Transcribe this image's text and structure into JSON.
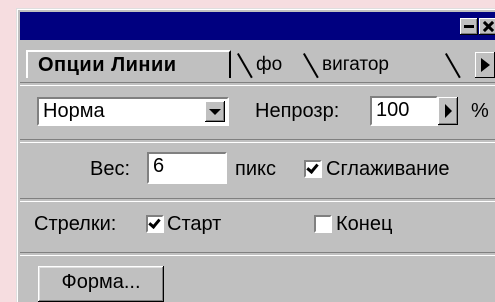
{
  "titlebar": {
    "minimize_icon": "minimize-icon",
    "close_icon": "close-icon",
    "color": "#000080"
  },
  "tabs": [
    {
      "label": "Опции Линии",
      "active": true
    },
    {
      "label": "фо",
      "active": false
    },
    {
      "label": "вигатор",
      "active": false
    }
  ],
  "tabs_scroll_icon": "arrow-right-icon",
  "blend": {
    "mode": "Норма",
    "opacity_label": "Непрозр:",
    "opacity_value": "100",
    "percent": "%"
  },
  "weight": {
    "label": "Вес:",
    "value": "6",
    "unit": "пикс"
  },
  "antialias": {
    "label": "Сглаживание",
    "checked": true
  },
  "arrows": {
    "label": "Стрелки:",
    "start": {
      "label": "Старт",
      "checked": true
    },
    "end": {
      "label": "Конец",
      "checked": false
    }
  },
  "shape_button": "Форма..."
}
